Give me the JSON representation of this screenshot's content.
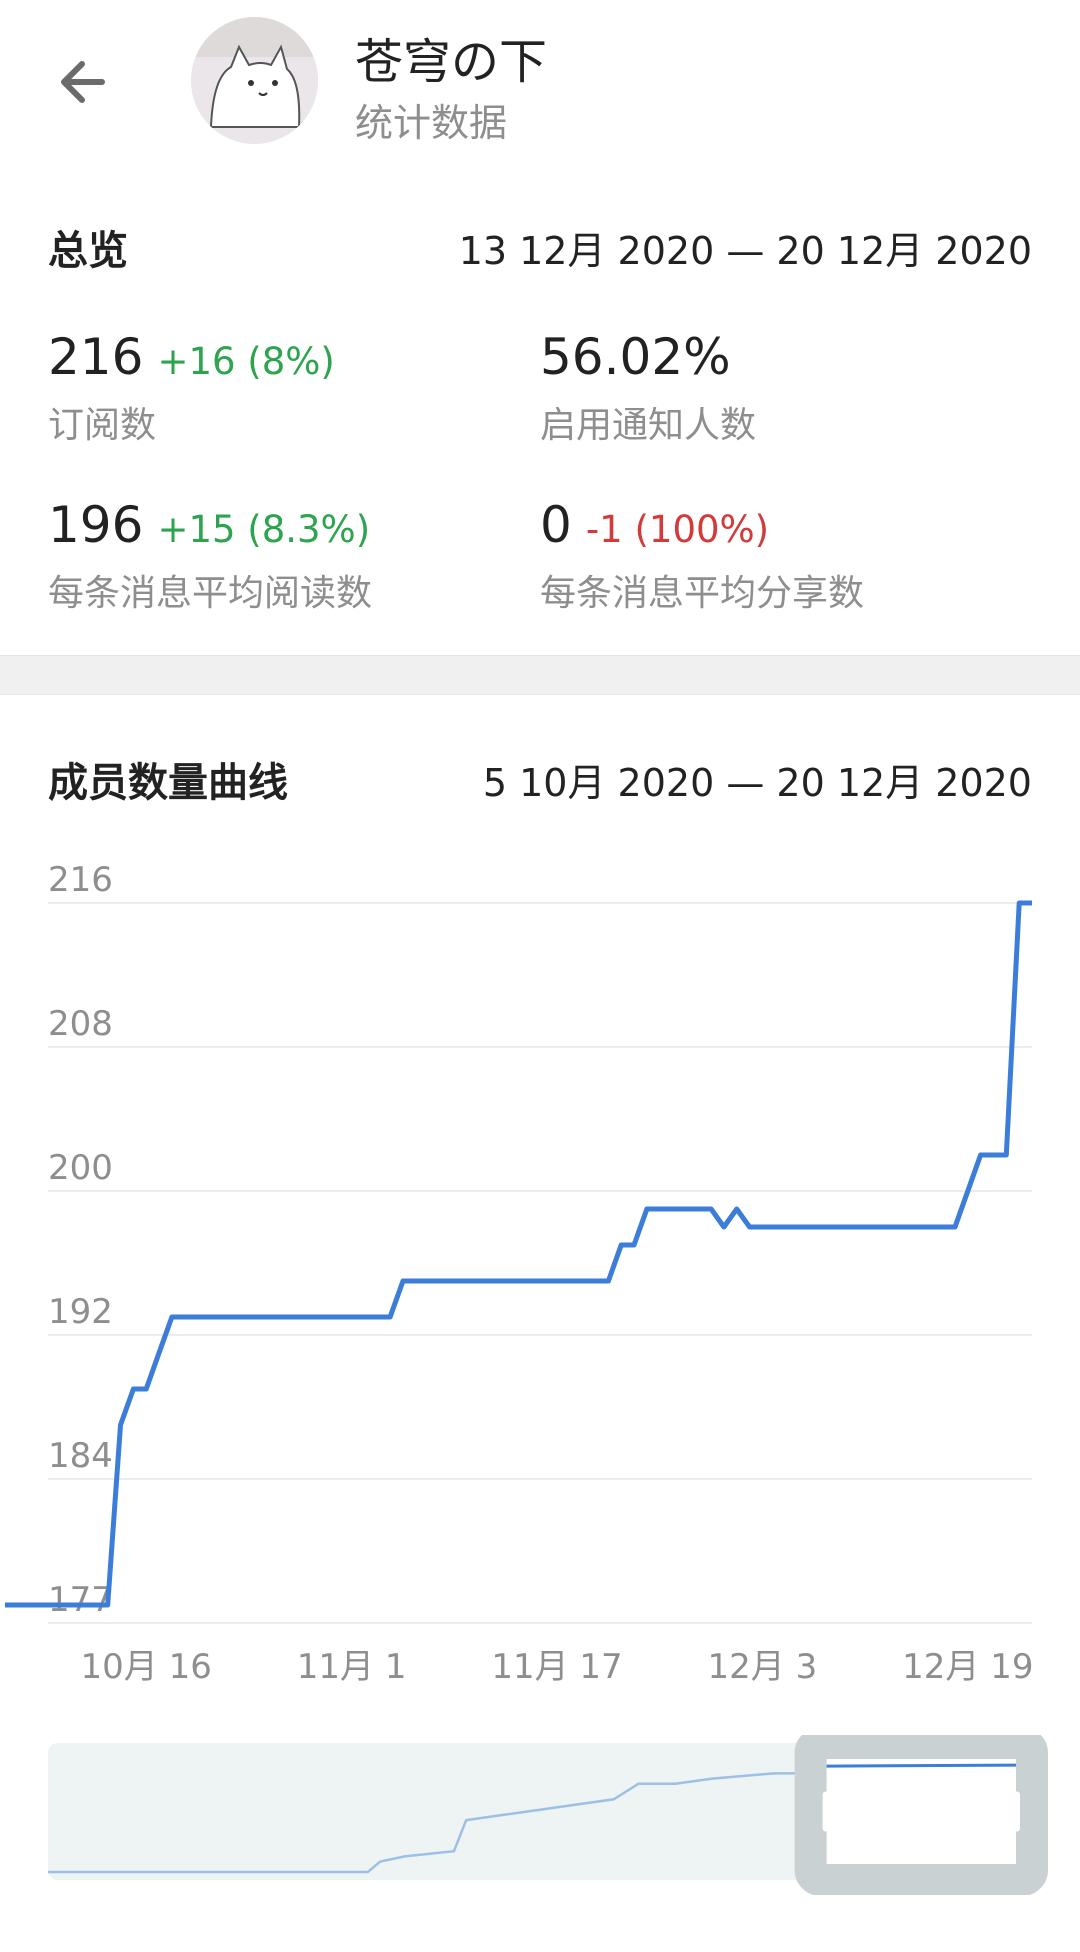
{
  "header": {
    "title": "苍穹の下",
    "subtitle": "统计数据",
    "icons": {
      "back": "arrow-left-icon",
      "avatar": "cat-avatar"
    }
  },
  "overview": {
    "title": "总览",
    "date_range": "13 12月 2020 — 20 12月 2020",
    "stats": [
      {
        "value": "216",
        "delta": "+16 (8%)",
        "trend": "up",
        "label": "订阅数"
      },
      {
        "value": "56.02%",
        "delta": "",
        "trend": "none",
        "label": "启用通知人数"
      },
      {
        "value": "196",
        "delta": "+15 (8.3%)",
        "trend": "up",
        "label": "每条消息平均阅读数"
      },
      {
        "value": "0",
        "delta": "-1 (100%)",
        "trend": "down",
        "label": "每条消息平均分享数"
      }
    ]
  },
  "members": {
    "title": "成员数量曲线",
    "date_range": "5 10月 2020 — 20 12月 2020"
  },
  "colors": {
    "line": "#3b7dd8",
    "positive": "#2ea44f",
    "negative": "#d33a3a",
    "muted": "#8e8e8e"
  },
  "chart_data": {
    "type": "line",
    "ylim": [
      176,
      216
    ],
    "y_ticks": [
      {
        "value": 177,
        "label": "177"
      },
      {
        "value": 184,
        "label": "184"
      },
      {
        "value": 192,
        "label": "192"
      },
      {
        "value": 200,
        "label": "200"
      },
      {
        "value": 208,
        "label": "208"
      },
      {
        "value": 216,
        "label": "216"
      }
    ],
    "x_ticks": [
      {
        "day": 11,
        "label": "10月 16"
      },
      {
        "day": 27,
        "label": "11月 1"
      },
      {
        "day": 43,
        "label": "11月 17"
      },
      {
        "day": 59,
        "label": "12月 3"
      },
      {
        "day": 75,
        "label": "12月 19"
      }
    ],
    "series": [
      {
        "points": [
          [
            0,
            177
          ],
          [
            8,
            177
          ],
          [
            9,
            187
          ],
          [
            10,
            189
          ],
          [
            11,
            189
          ],
          [
            12,
            191
          ],
          [
            13,
            193
          ],
          [
            30,
            193
          ],
          [
            31,
            195
          ],
          [
            47,
            195
          ],
          [
            48,
            197
          ],
          [
            49,
            197
          ],
          [
            50,
            199
          ],
          [
            55,
            199
          ],
          [
            56,
            198
          ],
          [
            57,
            199
          ],
          [
            58,
            198
          ],
          [
            74,
            198
          ],
          [
            76,
            202
          ],
          [
            78,
            202
          ],
          [
            79,
            216
          ],
          [
            80,
            216
          ]
        ]
      }
    ],
    "navigator_points": [
      [
        0,
        177
      ],
      [
        26,
        177
      ],
      [
        27,
        179
      ],
      [
        29,
        180
      ],
      [
        33,
        181
      ],
      [
        34,
        187
      ],
      [
        37,
        188
      ],
      [
        40,
        189
      ],
      [
        43,
        190
      ],
      [
        46,
        191
      ],
      [
        48,
        194
      ],
      [
        51,
        194
      ],
      [
        54,
        195
      ],
      [
        59,
        196
      ],
      [
        66,
        196
      ],
      [
        75,
        197
      ],
      [
        80,
        198
      ]
    ],
    "navigator_selection": [
      0.775,
      1.0
    ]
  }
}
